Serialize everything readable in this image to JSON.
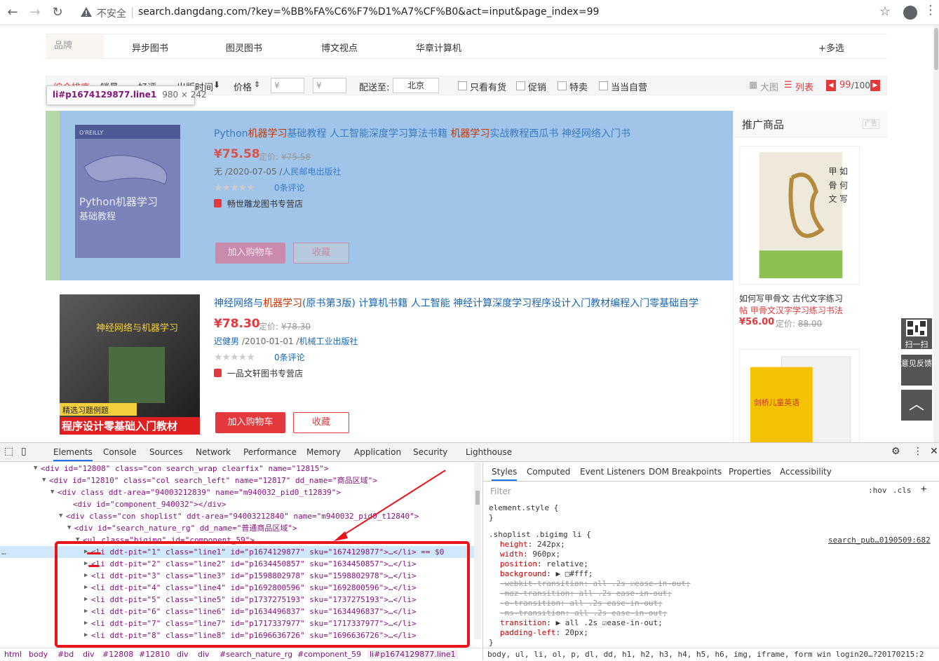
{
  "browser": {
    "insecure_label": "不安全",
    "url": "search.dangdang.com/?key=%BB%FA%C6%F7%D1%A7%CF%B0&act=input&page_index=99"
  },
  "brands": {
    "label": "品牌",
    "items": [
      "异步图书",
      "图灵图书",
      "博文视点",
      "华章计算机"
    ],
    "multi": "+多选"
  },
  "filters": {
    "sorts": [
      "综合排序",
      "销量",
      "好评",
      "出版时间",
      "价格"
    ],
    "price_from": "¥",
    "price_to": "¥",
    "ship_to_label": "配送至:",
    "city": "北京",
    "checks": [
      "只看有货",
      "促销",
      "特卖",
      "当当自营"
    ],
    "view_grid": "大图",
    "view_list": "列表",
    "page_current": "99",
    "page_total": "/100"
  },
  "inspect_tooltip": {
    "selector": "li#p1674129877.line1",
    "size": "980 × 242"
  },
  "products": [
    {
      "title_pre": "Python",
      "title_hl": "机器学习",
      "title_mid": "基础教程 人工智能深度学习算法书籍 ",
      "title_hl2": "机器学习",
      "title_post": "实战教程西瓜书 神经网络入门书",
      "price": "¥75.58",
      "list_label": "定价:",
      "list_price": "¥75.58",
      "author": "无",
      "date": " /2020-07-05 /",
      "publisher": "人民邮电出版社",
      "stars": "★★★★★",
      "reviews": "0条评论",
      "shop": "畅世雕龙图书专营店",
      "cart": "加入购物车",
      "fav": "收藏",
      "cover_lines": [
        "O'REILLY",
        "Python机器学习",
        "基础教程"
      ]
    },
    {
      "title_pre": "神经网络与",
      "title_hl": "机器学习",
      "title_mid": "(原书第3版) 计算机书籍 人工智能 神经计算深度学习程序设计入门教材编程入门零基础自学",
      "title_hl2": "",
      "title_post": "",
      "price": "¥78.30",
      "list_label": "定价:",
      "list_price": "¥78.30",
      "author": "迟健男",
      "date": " /2010-01-01 /",
      "publisher": "机械工业出版社",
      "stars": "★★★★★",
      "reviews": "0条评论",
      "shop": "一品文轩图书专营店",
      "cart": "加入购物车",
      "fav": "收藏",
      "cover_lines": [
        "神经网络与机器学习",
        "精选习题例题",
        "程序设计零基础入门教材"
      ]
    }
  ],
  "promo": {
    "title": "推广商品",
    "ad": "广告",
    "item1_name": "如何写甲骨文 古代文字练习",
    "item1_sub": "帖 甲骨文汉字学习练习书法",
    "item1_price": "¥56.00",
    "item1_list_label": "定价:",
    "item1_list_price": "88.00",
    "cover1_text": [
      "甲 如",
      "骨 何",
      "文 写"
    ],
    "cover2_text": "剑桥儿童英语"
  },
  "side": {
    "qr": "扫一扫",
    "feedback": "意见反馈"
  },
  "devtools": {
    "tabs": [
      "Elements",
      "Console",
      "Sources",
      "Network",
      "Performance",
      "Memory",
      "Application",
      "Security",
      "Lighthouse"
    ],
    "dom_lines": [
      {
        "indent": 48,
        "arrow": "▼",
        "html": "<div id=\"12808\" class=\"con search_wrap clearfix\" name=\"12815\">"
      },
      {
        "indent": 60,
        "arrow": "▼",
        "html": "<div id=\"12810\" class=\"col search_left\" name=\"12817\" dd_name=\"商品区域\">"
      },
      {
        "indent": 72,
        "arrow": "▼",
        "html": "<div class ddt-area=\"94003212839\" name=\"m940032_pid0_t12839\">"
      },
      {
        "indent": 94,
        "arrow": "",
        "html": "<div id=\"component_940032\"></div>"
      },
      {
        "indent": 84,
        "arrow": "▼",
        "html": "<div class=\"con shoplist\" ddt-area=\"94003212840\" name=\"m940032_pid0_t12840\">"
      },
      {
        "indent": 96,
        "arrow": "▼",
        "html": "<div id=\"search_nature_rg\" dd_name=\"普通商品区域\">"
      },
      {
        "indent": 108,
        "arrow": "▼",
        "html": "<ul class=\"bigimg\" id=\"component_59\">"
      },
      {
        "indent": 120,
        "arrow": "▶",
        "html": "<li ddt-pit=\"1\" class=\"line1\" id=\"p1674129877\" sku=\"1674129877\">…</li> == $0"
      },
      {
        "indent": 120,
        "arrow": "▶",
        "html": "<li ddt-pit=\"2\" class=\"line2\" id=\"p1634450857\" sku=\"1634450857\">…</li>"
      },
      {
        "indent": 120,
        "arrow": "▶",
        "html": "<li ddt-pit=\"3\" class=\"line3\" id=\"p1598802978\" sku=\"1598802978\">…</li>"
      },
      {
        "indent": 120,
        "arrow": "▶",
        "html": "<li ddt-pit=\"4\" class=\"line4\" id=\"p1692800596\" sku=\"1692800596\">…</li>"
      },
      {
        "indent": 120,
        "arrow": "▶",
        "html": "<li ddt-pit=\"5\" class=\"line5\" id=\"p1737275193\" sku=\"1737275193\">…</li>"
      },
      {
        "indent": 120,
        "arrow": "▶",
        "html": "<li ddt-pit=\"6\" class=\"line6\" id=\"p1634496837\" sku=\"1634496837\">…</li>"
      },
      {
        "indent": 120,
        "arrow": "▶",
        "html": "<li ddt-pit=\"7\" class=\"line7\" id=\"p1717337977\" sku=\"1717337977\">…</li>"
      },
      {
        "indent": 120,
        "arrow": "▶",
        "html": "<li ddt-pit=\"8\" class=\"line8\" id=\"p1696636726\" sku=\"1696636726\">…</li>"
      }
    ],
    "breadcrumbs": [
      "html",
      "body",
      "#bd",
      "div",
      "#12808",
      "#12810",
      "div",
      "div",
      "#search_nature_rg",
      "#component_59",
      "li#p1674129877.line1"
    ],
    "styles_tabs": [
      "Styles",
      "Computed",
      "Event Listeners",
      "DOM Breakpoints",
      "Properties",
      "Accessibility"
    ],
    "filter_placeholder": "Filter",
    "hov": ":hov",
    "cls": ".cls",
    "plus": "+",
    "element_style": "element.style {",
    "close_brace": "}",
    "rule_selector": ".shoplist .bigimg li {",
    "rule_source": "search_pub…0190509:682",
    "declarations": [
      {
        "prop": "height",
        "value": "242px;",
        "struck": false
      },
      {
        "prop": "width",
        "value": "960px;",
        "struck": false
      },
      {
        "prop": "position",
        "value": "relative;",
        "struck": false
      },
      {
        "prop": "background",
        "value": "▶ □#fff;",
        "struck": false
      },
      {
        "prop": "-webkit-transition",
        "value": "all .2s ☑ease-in-out;",
        "struck": true
      },
      {
        "prop": "-moz-transition",
        "value": "all .2s ease-in-out;",
        "struck": true
      },
      {
        "prop": "-o-transition",
        "value": "all .2s ease-in-out;",
        "struck": true
      },
      {
        "prop": "-ms-transition",
        "value": "all .2s ease-in-out;",
        "struck": true
      },
      {
        "prop": "transition",
        "value": "▶ all .2s ☑ease-in-out;",
        "struck": false
      },
      {
        "prop": "padding-left",
        "value": "20px;",
        "struck": false
      }
    ],
    "footer": "body, ul, li, ol, p, dl, dd, h1, h2, h3, h4, h5, h6, img, iframe, form    win login20…?20170215:2"
  }
}
